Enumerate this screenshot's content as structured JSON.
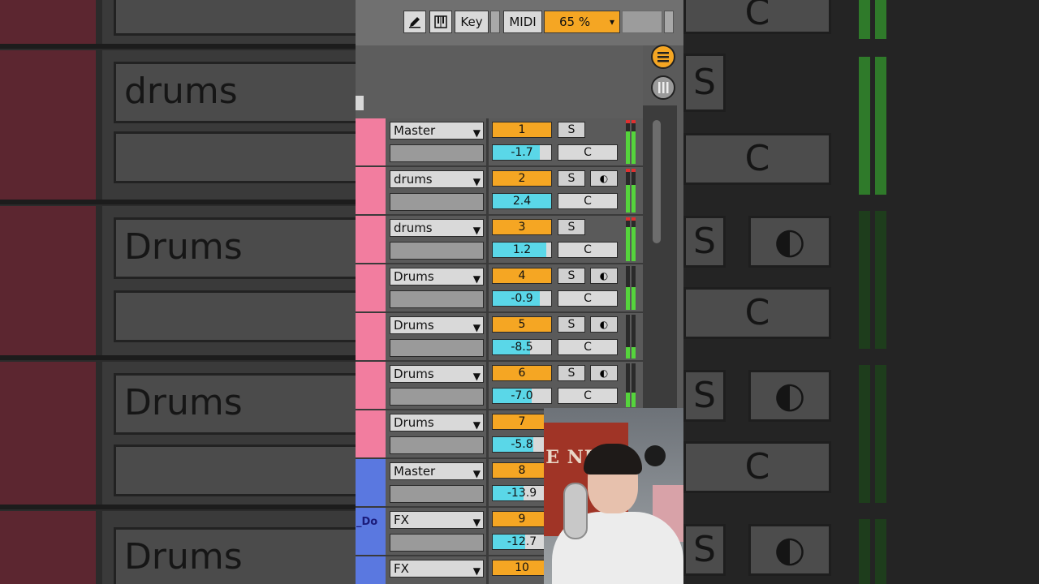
{
  "toolbar": {
    "pencil_icon": "pencil-icon",
    "keyboard_icon": "piano-keys-icon",
    "key_label": "Key",
    "midi_label": "MIDI",
    "zoom_value": "65 %",
    "zoom_arrow": "▾"
  },
  "side_buttons": {
    "menu_icon": "hamburger-menu-icon",
    "view_icon": "mixer-view-icon"
  },
  "tracks": [
    {
      "name": "Master",
      "num": "1",
      "vol": "-1.7",
      "solo": "S",
      "cue": "C",
      "rec": "",
      "color": "#f27d9f",
      "label": ""
    },
    {
      "name": "drums",
      "num": "2",
      "vol": "2.4",
      "solo": "S",
      "cue": "C",
      "rec": "◐",
      "color": "#f27d9f",
      "label": ""
    },
    {
      "name": "drums",
      "num": "3",
      "vol": "1.2",
      "solo": "S",
      "cue": "C",
      "rec": "",
      "color": "#f27d9f",
      "label": ""
    },
    {
      "name": "Drums",
      "num": "4",
      "vol": "-0.9",
      "solo": "S",
      "cue": "C",
      "rec": "◐",
      "color": "#f27d9f",
      "label": ""
    },
    {
      "name": "Drums",
      "num": "5",
      "vol": "-8.5",
      "solo": "S",
      "cue": "C",
      "rec": "◐",
      "color": "#f27d9f",
      "label": ""
    },
    {
      "name": "Drums",
      "num": "6",
      "vol": "-7.0",
      "solo": "S",
      "cue": "C",
      "rec": "◐",
      "color": "#f27d9f",
      "label": ""
    },
    {
      "name": "Drums",
      "num": "7",
      "vol": "-5.8",
      "solo": "",
      "cue": "",
      "rec": "",
      "color": "#f27d9f",
      "label": ""
    },
    {
      "name": "Master",
      "num": "8",
      "vol": "-13.9",
      "solo": "",
      "cue": "",
      "rec": "",
      "color": "#5a78e0",
      "label": ""
    },
    {
      "name": "FX",
      "num": "9",
      "vol": "-12.7",
      "solo": "",
      "cue": "",
      "rec": "",
      "color": "#5a78e0",
      "label": "_Do"
    },
    {
      "name": "FX",
      "num": "10",
      "vol": "",
      "solo": "",
      "cue": "",
      "rec": "",
      "color": "#5a78e0",
      "label": ""
    }
  ],
  "dropdown_arrow": "▼",
  "background_left": {
    "names": [
      "drums",
      "Drums",
      "Drums",
      "Drums"
    ]
  },
  "background_right": {
    "buttons": [
      "C",
      "S",
      "C",
      "S",
      "◐",
      "C",
      "S",
      "◐",
      "C",
      "S",
      "◐"
    ]
  },
  "webcam": {
    "poster_text": "E NEST"
  }
}
